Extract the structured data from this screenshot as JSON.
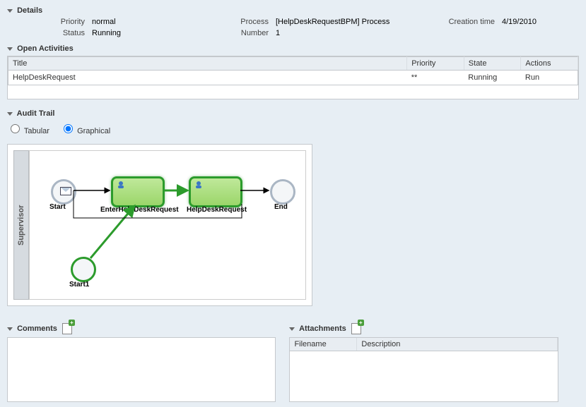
{
  "sections": {
    "details": "Details",
    "open_activities": "Open Activities",
    "audit_trail": "Audit Trail",
    "comments": "Comments",
    "attachments": "Attachments"
  },
  "details": {
    "priority_label": "Priority",
    "priority_value": "normal",
    "status_label": "Status",
    "status_value": "Running",
    "process_label": "Process",
    "process_value": "[HelpDeskRequestBPM] Process",
    "number_label": "Number",
    "number_value": "1",
    "creation_label": "Creation time",
    "creation_value": "4/19/2010"
  },
  "open_activities": {
    "columns": {
      "title": "Title",
      "priority": "Priority",
      "state": "State",
      "actions": "Actions"
    },
    "rows": [
      {
        "title": "HelpDeskRequest",
        "priority": "**",
        "state": "Running",
        "action": "Run"
      }
    ]
  },
  "audit": {
    "tabular_label": "Tabular",
    "graphical_label": "Graphical",
    "lane": "Supervisor",
    "nodes": {
      "start": "Start",
      "enter": "EnterHelpDeskRequest",
      "request": "HelpDeskRequest",
      "end": "End",
      "start1": "Start1"
    }
  },
  "attachments": {
    "columns": {
      "filename": "Filename",
      "description": "Description"
    }
  }
}
